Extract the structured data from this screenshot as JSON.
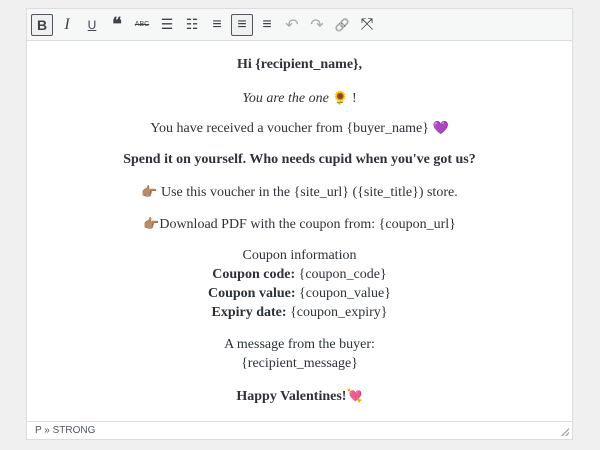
{
  "toolbar": {
    "buttons": [
      {
        "name": "bold",
        "glyph": "B"
      },
      {
        "name": "italic",
        "glyph": "I"
      },
      {
        "name": "underline",
        "glyph": "U"
      },
      {
        "name": "blockquote",
        "glyph": "❝"
      },
      {
        "name": "strikethrough",
        "glyph": "ABC"
      },
      {
        "name": "bullet-list",
        "glyph": "☰"
      },
      {
        "name": "numbered-list",
        "glyph": "☷"
      },
      {
        "name": "align-left",
        "glyph": "≡"
      },
      {
        "name": "align-center",
        "glyph": "≡"
      },
      {
        "name": "align-right",
        "glyph": "≡"
      },
      {
        "name": "undo",
        "glyph": "↶"
      },
      {
        "name": "redo",
        "glyph": "↷"
      },
      {
        "name": "link",
        "glyph": "🔗"
      },
      {
        "name": "fullscreen",
        "glyph": "⤧"
      }
    ]
  },
  "content": {
    "greeting": "Hi {recipient_name},",
    "tagline": "You are the one",
    "tagline_emoji": "🌻",
    "tagline_end": "!",
    "received": "You have received a voucher from {buyer_name}",
    "received_emoji": "💜",
    "headline": "Spend it on yourself. Who needs cupid when you've got us?",
    "pointer_emoji": "👉🏽",
    "use_line": "Use this voucher in the {site_url} ({site_title}) store.",
    "download_line": "Download PDF with the coupon from: {coupon_url}",
    "coupon_info": "Coupon information",
    "code_label": "Coupon code:",
    "code_value": "{coupon_code}",
    "value_label": "Coupon value:",
    "value_value": "{coupon_value}",
    "expiry_label": "Expiry date:",
    "expiry_value": "{coupon_expiry}",
    "message_label": "A message from the buyer:",
    "message_value": "{recipient_message}",
    "closing": "Happy Valentines!",
    "closing_emoji": "💘"
  },
  "status": {
    "path": "P » STRONG"
  }
}
